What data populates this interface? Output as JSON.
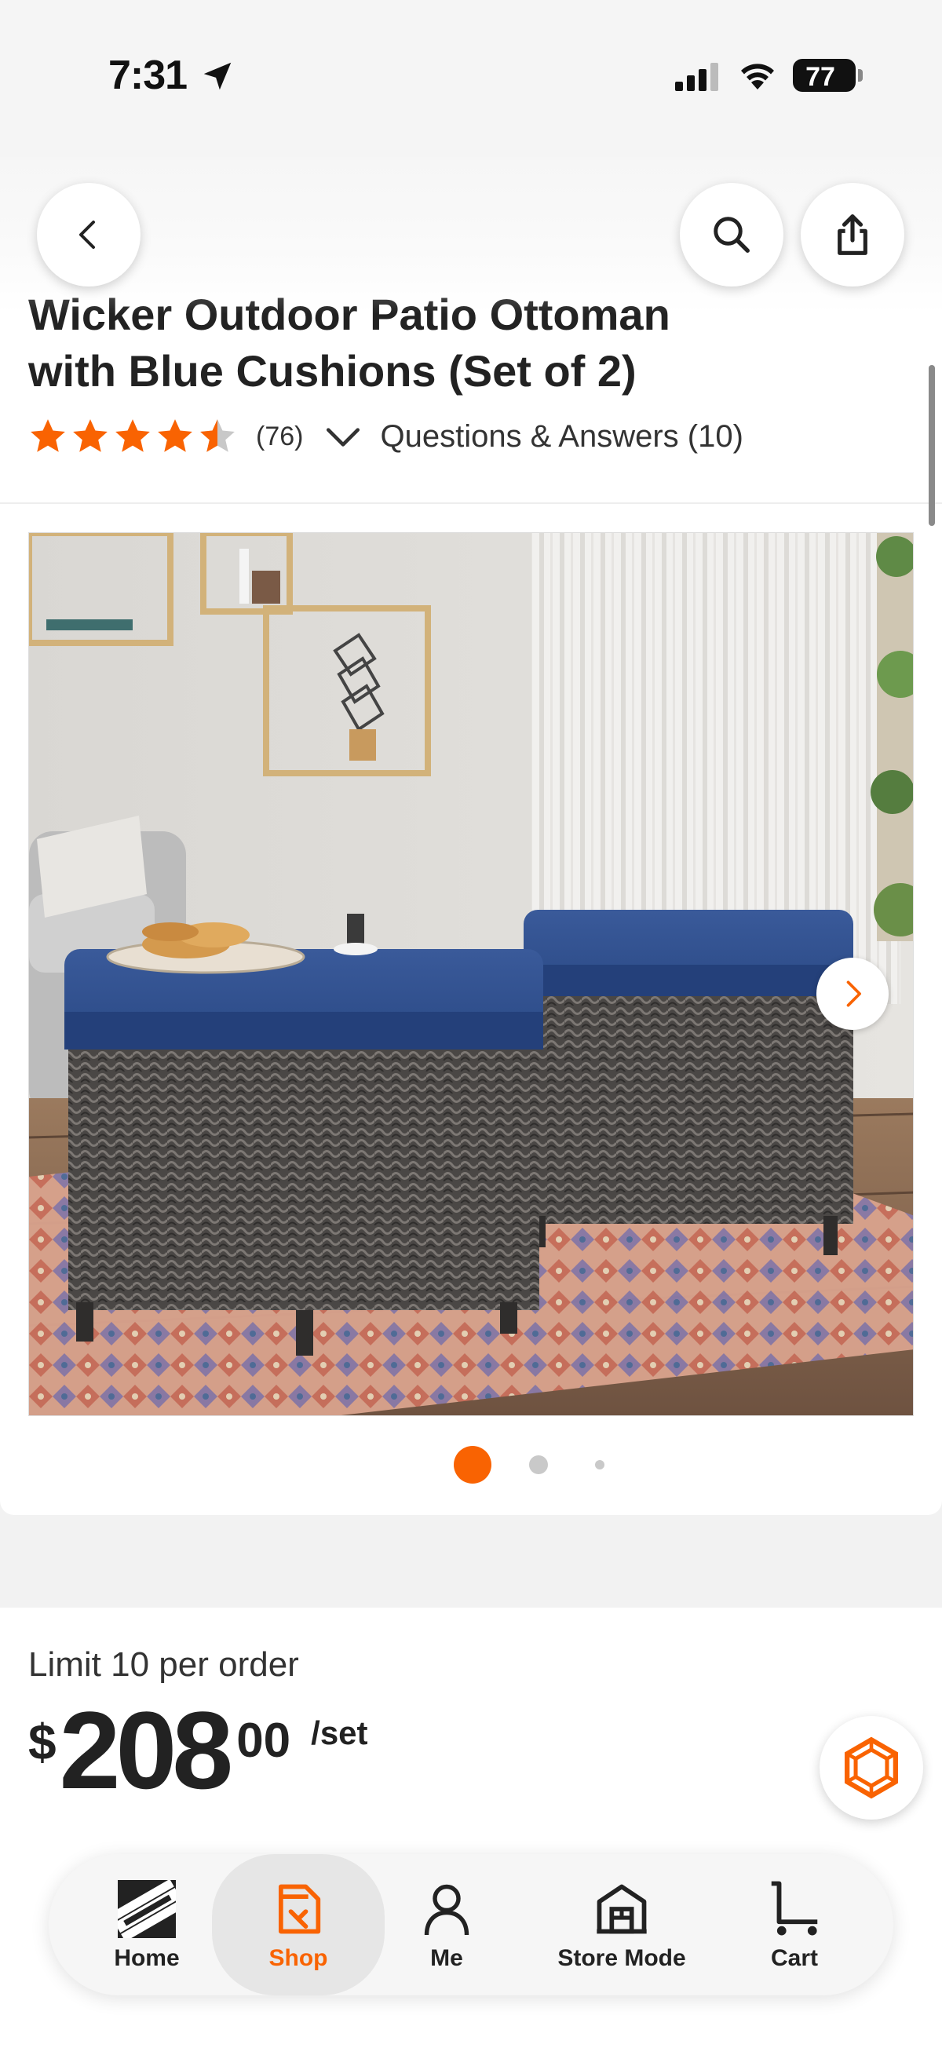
{
  "status_bar": {
    "time": "7:31",
    "battery": "77"
  },
  "product": {
    "title_line1_partial": "Wicker Outdoor Patio Ottoman",
    "title_line2": "with Blue Cushions (Set of 2)",
    "rating_value": 4.5,
    "rating_count": "(76)",
    "qa_label": "Questions & Answers (10)"
  },
  "gallery": {
    "slide_count": 3,
    "active_index": 0
  },
  "pricing": {
    "limit": "Limit 10 per order",
    "currency": "$",
    "dollars": "208",
    "cents": "00",
    "unit": "/set"
  },
  "bottom_nav": {
    "items": [
      {
        "label": "Home",
        "icon": "home-depot-logo-icon"
      },
      {
        "label": "Shop",
        "icon": "shop-tag-icon",
        "active": true
      },
      {
        "label": "Me",
        "icon": "person-icon"
      },
      {
        "label": "Store Mode",
        "icon": "store-icon"
      },
      {
        "label": "Cart",
        "icon": "cart-icon"
      }
    ]
  },
  "colors": {
    "accent": "#f96302",
    "star": "#f96302",
    "cushion": "#2b4a86"
  }
}
